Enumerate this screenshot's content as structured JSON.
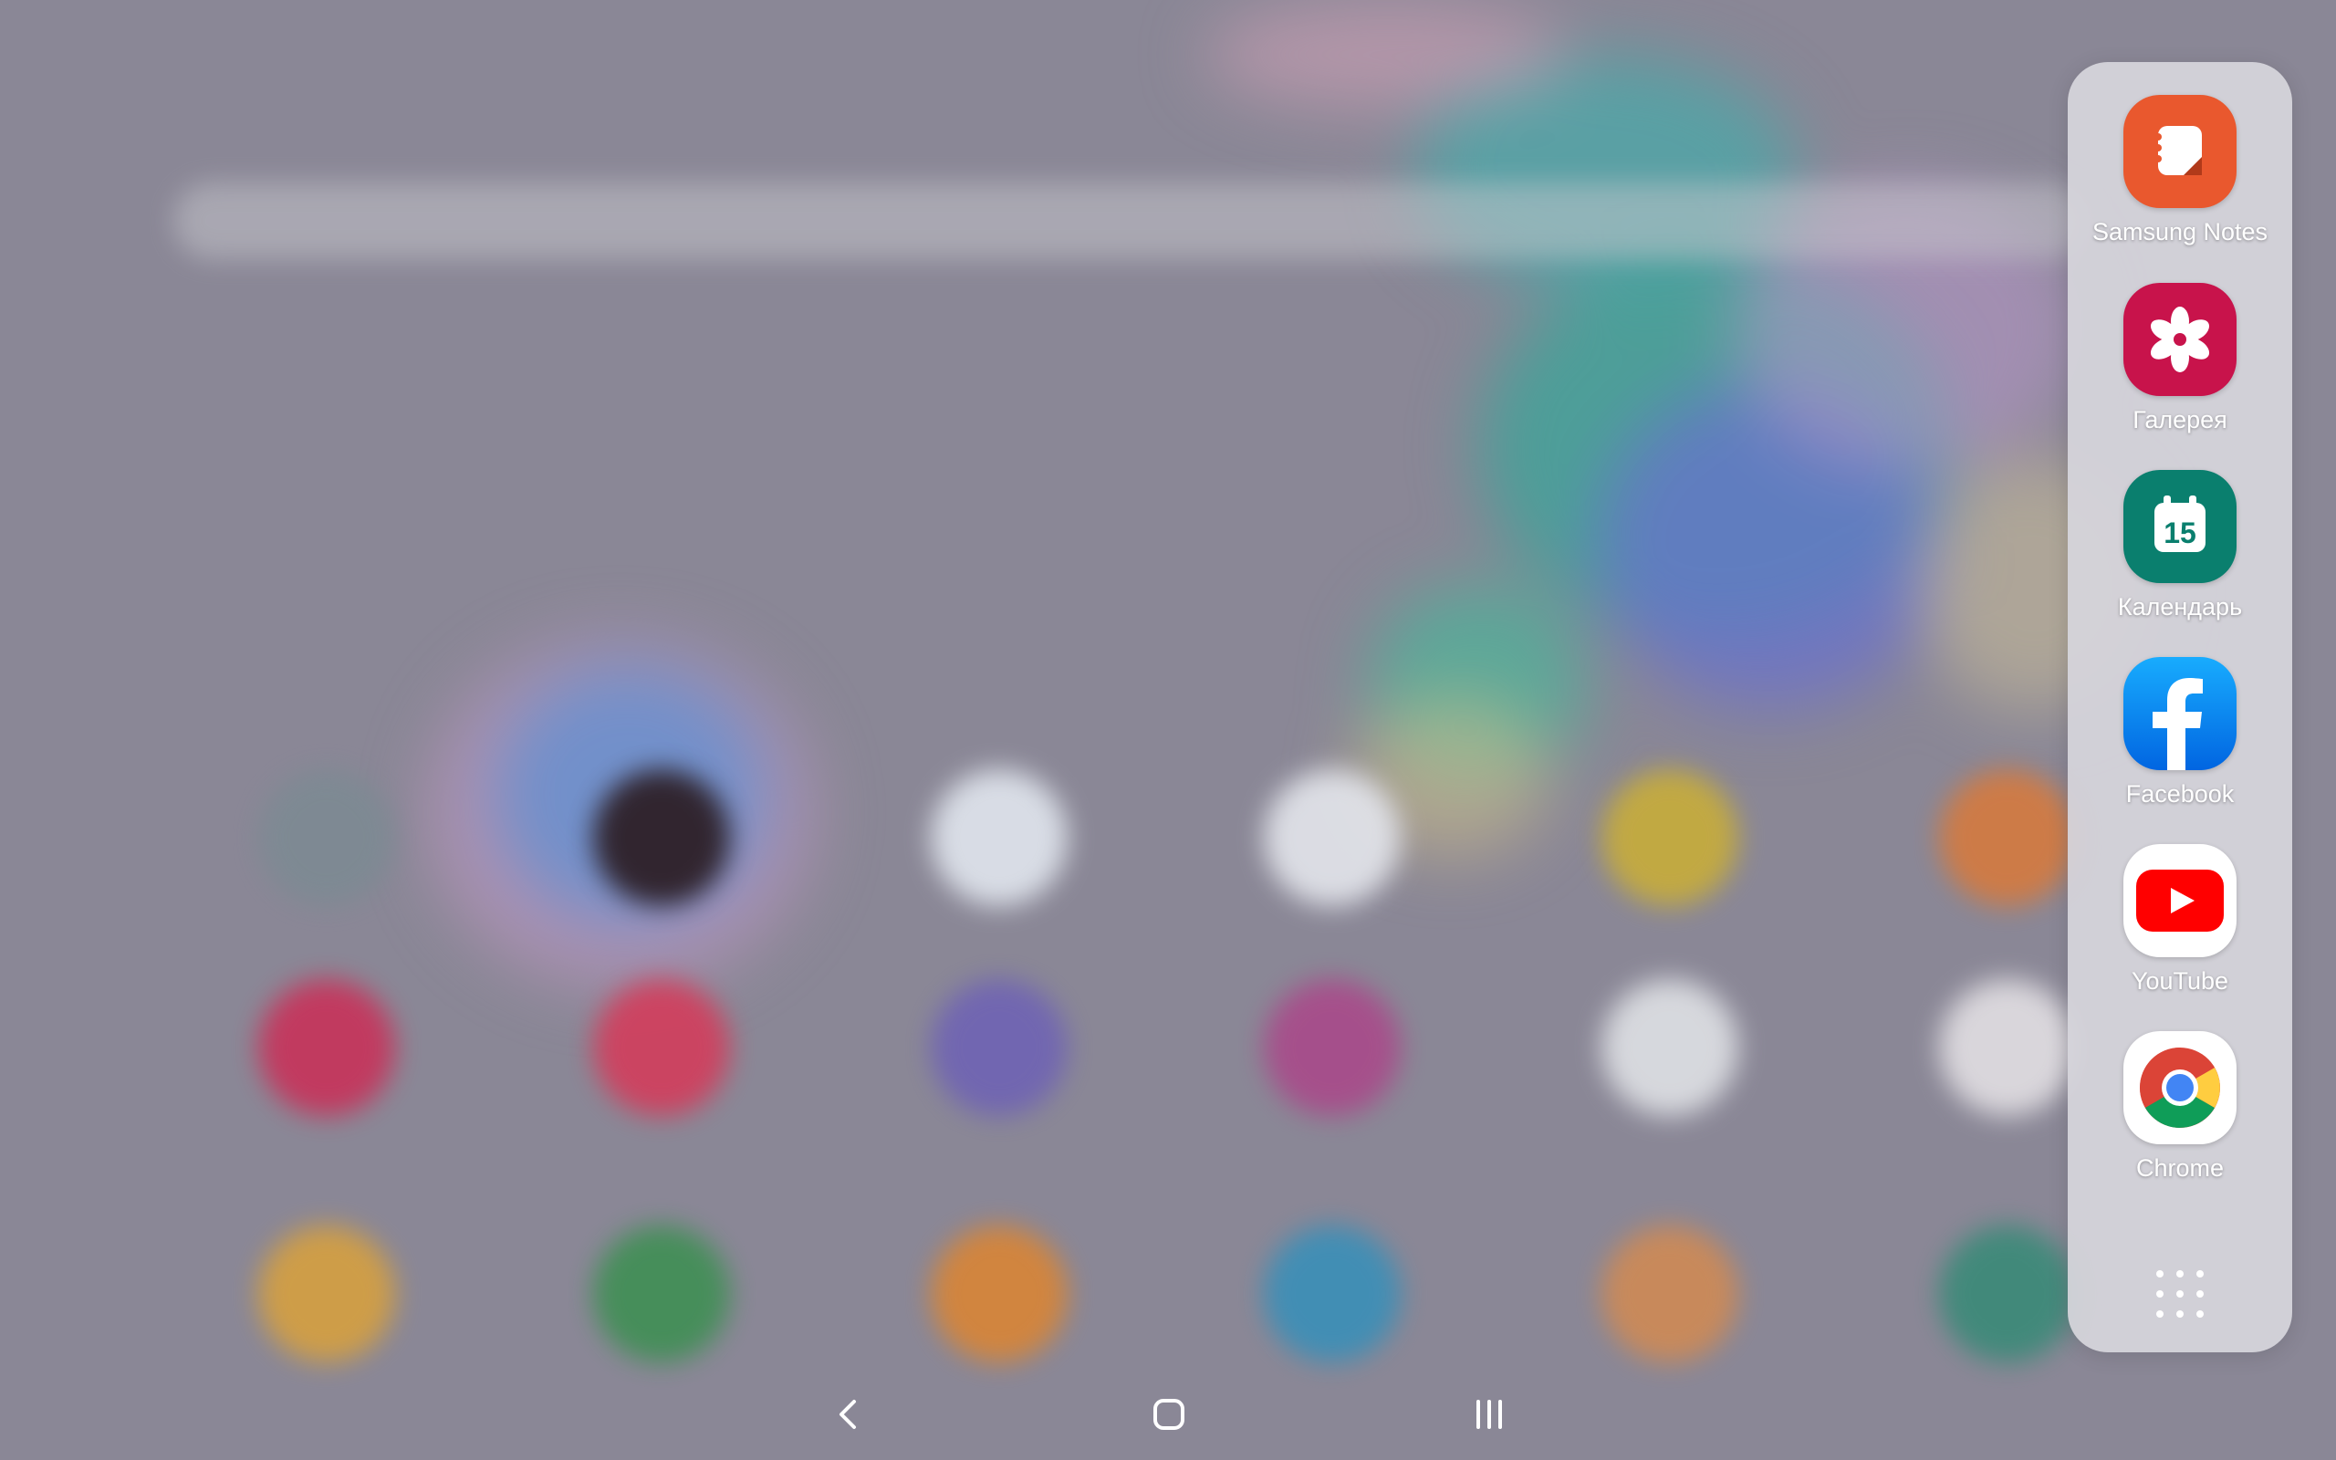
{
  "edge_panel": {
    "apps": [
      {
        "label": "Samsung Notes",
        "icon": "samsung-notes-icon",
        "color": "#e9582e"
      },
      {
        "label": "Галерея",
        "icon": "gallery-icon",
        "color": "#c8134b"
      },
      {
        "label": "Календарь",
        "icon": "calendar-icon",
        "color": "#0a7f6e",
        "day": "15"
      },
      {
        "label": "Facebook",
        "icon": "facebook-icon",
        "color": "#1877f2"
      },
      {
        "label": "YouTube",
        "icon": "youtube-icon",
        "color": "#ff0000"
      },
      {
        "label": "Chrome",
        "icon": "chrome-icon",
        "color": "#ffffff"
      }
    ],
    "all_apps_icon": "apps-grid-icon"
  },
  "nav_bar": {
    "back_icon": "back-icon",
    "home_icon": "home-icon",
    "recents_icon": "recents-icon"
  }
}
